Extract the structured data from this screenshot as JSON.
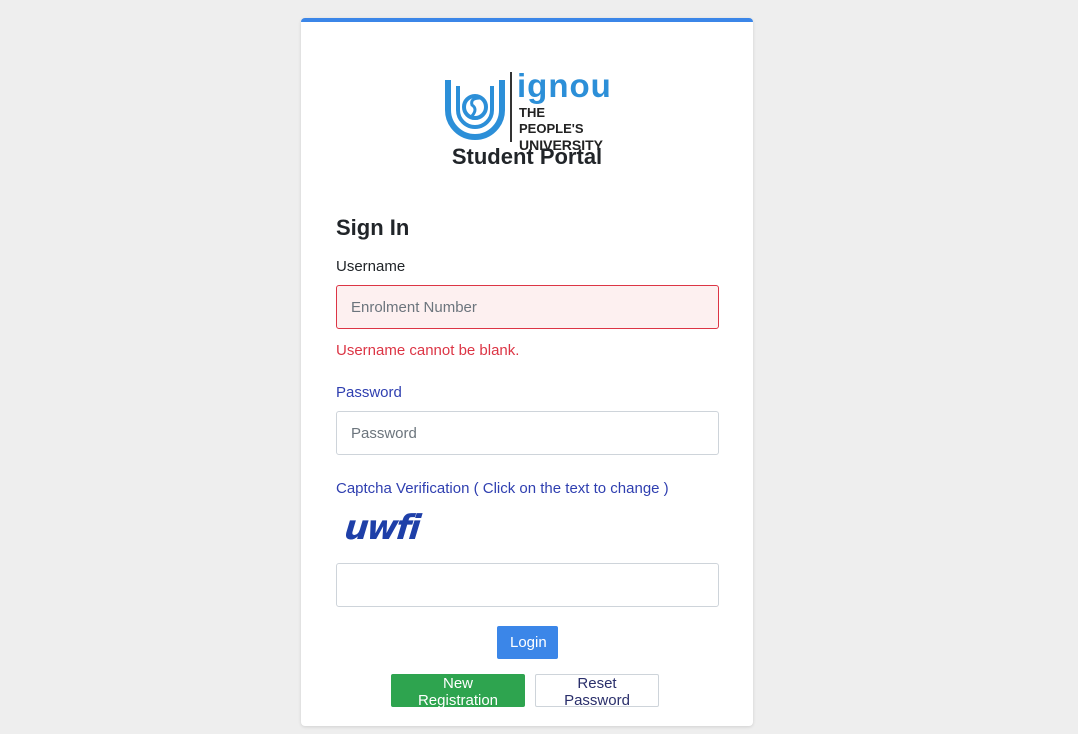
{
  "logo": {
    "brand": "ignou",
    "tagline_line1": "THE PEOPLE'S",
    "tagline_line2": "UNIVERSITY"
  },
  "header": {
    "title": "Student Portal"
  },
  "form": {
    "heading": "Sign In",
    "username": {
      "label": "Username",
      "placeholder": "Enrolment Number",
      "value": "",
      "error": "Username cannot be blank."
    },
    "password": {
      "label": "Password",
      "placeholder": "Password",
      "value": ""
    },
    "captcha": {
      "label": "Captcha Verification ( Click on the text to change )",
      "text": "uwfi",
      "value": ""
    },
    "login_label": "Login",
    "new_registration_label": "New Registration",
    "reset_password_label": "Reset Password"
  },
  "colors": {
    "accent": "#3b86e8",
    "success": "#2ea44f",
    "error": "#dc3545",
    "label_blue": "#2f3fb0",
    "logo_blue": "#2c8fd8"
  }
}
